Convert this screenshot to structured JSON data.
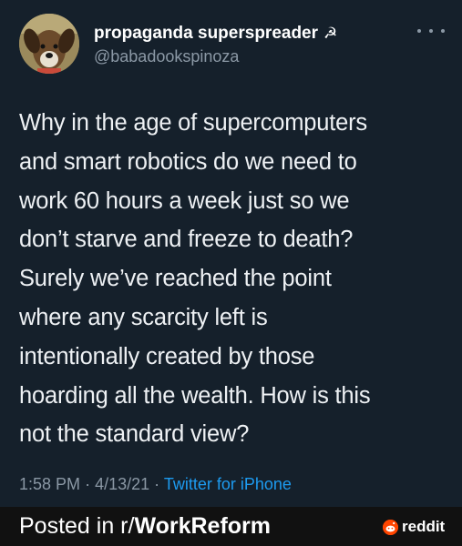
{
  "tweet": {
    "display_name": "propaganda superspreader",
    "name_emoji": "☭",
    "handle": "@babadookspinoza",
    "text_lines": [
      "Why in the age of supercomputers",
      "and smart robotics do we need to",
      "work 60 hours a week just so we",
      "don’t starve and freeze to death?",
      "Surely we’ve reached the point",
      "where any scarcity left is",
      "intentionally created by those",
      "hoarding all the wealth. How is this",
      "not the standard view?"
    ],
    "time": "1:58 PM",
    "date": "4/13/21",
    "separator": "·",
    "source": "Twitter for iPhone"
  },
  "footer": {
    "posted_prefix": "Posted in r/",
    "subreddit": "WorkReform",
    "brand": "reddit"
  },
  "colors": {
    "background": "#15202b",
    "footer_background": "#111111",
    "link": "#1d9bf0",
    "secondary_text": "#8b98a5",
    "reddit_orange": "#ff4500"
  },
  "icons": {
    "avatar": "dog-avatar",
    "more": "more-horizontal-icon",
    "brand_logo": "reddit-snoo-icon"
  }
}
